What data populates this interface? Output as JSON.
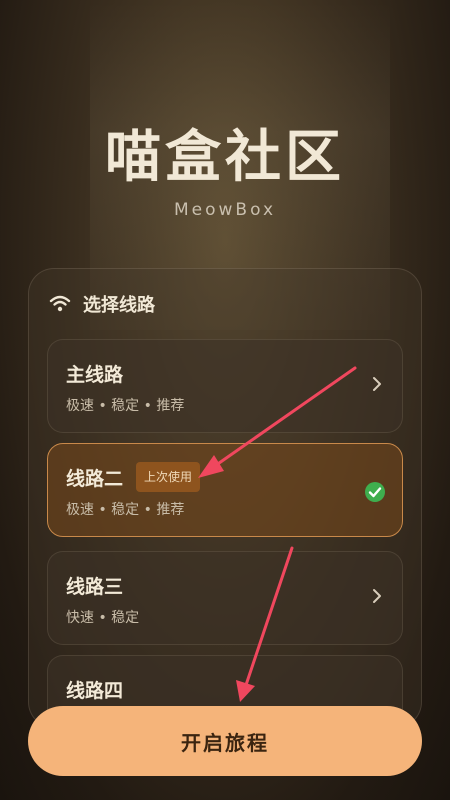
{
  "app": {
    "title": "喵盒社区",
    "subtitle": "MeowBox"
  },
  "route_panel": {
    "title": "选择线路",
    "icon": "wifi-icon",
    "routes": [
      {
        "name": "主线路",
        "desc": "极速 • 稳定 • 推荐",
        "selected": false,
        "icon": "chevron-right-icon"
      },
      {
        "name": "线路二",
        "desc": "极速 • 稳定 • 推荐",
        "selected": true,
        "badge": "上次使用",
        "icon": "check-circle-icon"
      },
      {
        "name": "线路三",
        "desc": "快速 • 稳定",
        "selected": false,
        "icon": "chevron-right-icon"
      },
      {
        "name": "线路四",
        "desc": "",
        "selected": false
      }
    ]
  },
  "start_button": {
    "label": "开启旅程"
  },
  "colors": {
    "accent": "#f5b47a",
    "selected_border": "#c9894a",
    "check": "#3fae4e",
    "annotation_arrow": "#f0475e"
  }
}
